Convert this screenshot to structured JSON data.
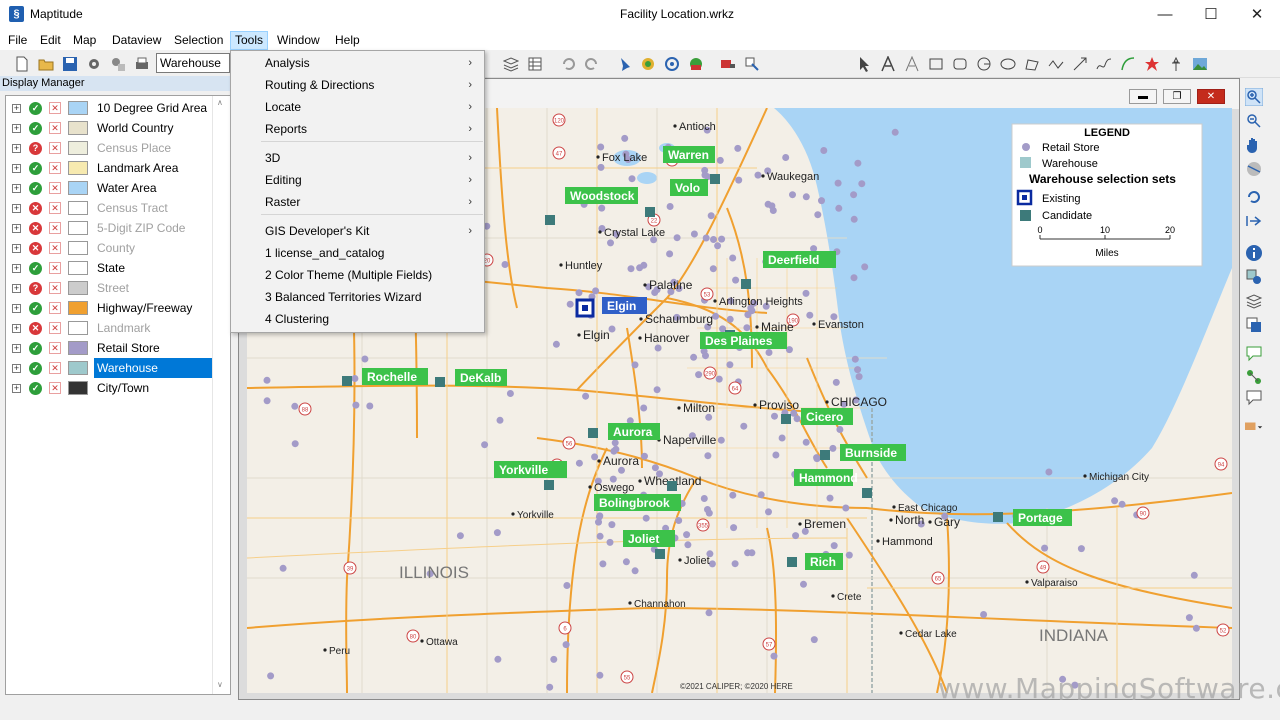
{
  "window": {
    "app_title": "Maptitude",
    "doc_title": "Facility Location.wrkz",
    "minimize": "—",
    "maximize": "☐",
    "close": "✕"
  },
  "menubar": [
    "File",
    "Edit",
    "Map",
    "Dataview",
    "Selection",
    "Tools",
    "Window",
    "Help"
  ],
  "toolbar": {
    "layer_select": "Warehouse"
  },
  "display_manager": {
    "header": "Display Manager",
    "layers": [
      {
        "label": "10 Degree Grid Area",
        "visible": "on",
        "swatch": "#a9d4f5",
        "dim": false
      },
      {
        "label": "World Country",
        "visible": "on",
        "swatch": "#e8e2cc",
        "dim": false
      },
      {
        "label": "Census Place",
        "visible": "q",
        "swatch": "#eeeedd",
        "dim": true
      },
      {
        "label": "Landmark Area",
        "visible": "on",
        "swatch": "#f7eab0",
        "dim": false
      },
      {
        "label": "Water Area",
        "visible": "on",
        "swatch": "#a9d4f5",
        "dim": false
      },
      {
        "label": "Census Tract",
        "visible": "off",
        "swatch": "#ffffff",
        "dim": true
      },
      {
        "label": "5-Digit ZIP Code",
        "visible": "off",
        "swatch": "#ffffff",
        "dim": true
      },
      {
        "label": "County",
        "visible": "off",
        "swatch": "#ffffff",
        "dim": true
      },
      {
        "label": "State",
        "visible": "on",
        "swatch": "#ffffff",
        "dim": false
      },
      {
        "label": "Street",
        "visible": "q",
        "swatch": "#cccccc",
        "dim": true
      },
      {
        "label": "Highway/Freeway",
        "visible": "on",
        "swatch": "#f0a030",
        "dim": false
      },
      {
        "label": "Landmark",
        "visible": "off",
        "swatch": "#ffffff",
        "dim": true
      },
      {
        "label": "Retail Store",
        "visible": "on",
        "swatch": "#a39bc8",
        "dim": false
      },
      {
        "label": "Warehouse",
        "visible": "on",
        "swatch": "#9ec9cc",
        "dim": false
      },
      {
        "label": "City/Town",
        "visible": "on",
        "swatch": "#333333",
        "dim": false
      }
    ]
  },
  "tools_menu": {
    "items": [
      {
        "label": "Analysis",
        "submenu": true
      },
      {
        "label": "Routing & Directions",
        "submenu": true
      },
      {
        "label": "Locate",
        "submenu": true
      },
      {
        "label": "Reports",
        "submenu": true
      },
      {
        "label": "3D",
        "submenu": true
      },
      {
        "label": "Editing",
        "submenu": true
      },
      {
        "label": "Raster",
        "submenu": true
      },
      {
        "label": "GIS Developer's Kit",
        "submenu": true
      },
      {
        "label": "1 license_and_catalog",
        "submenu": false
      },
      {
        "label": "2 Color Theme (Multiple Fields)",
        "submenu": false
      },
      {
        "label": "3 Balanced Territories Wizard",
        "submenu": false
      },
      {
        "label": "4 Clustering",
        "submenu": false
      }
    ]
  },
  "map": {
    "legend": {
      "title": "LEGEND",
      "items": [
        "Retail Store",
        "Warehouse"
      ],
      "subtitle": "Warehouse selection sets",
      "sets": [
        "Existing",
        "Candidate"
      ],
      "scale_ticks": [
        "0",
        "10",
        "20"
      ],
      "scale_unit": "Miles"
    },
    "warehouses": [
      "Warren",
      "Volo",
      "Woodstock",
      "Deerfield",
      "Elgin",
      "Des Plaines",
      "Rochelle",
      "DeKalb",
      "Aurora",
      "Cicero",
      "Burnside",
      "Yorkville",
      "Hammond",
      "Bolingbrook",
      "Joliet",
      "Rich",
      "Portage"
    ],
    "cities": [
      "Antioch",
      "Fox Lake",
      "Waukegan",
      "Crystal Lake",
      "Huntley",
      "Palatine",
      "Arlington Heights",
      "Schaumburg",
      "Maine",
      "Evanston",
      "Elgin",
      "Hanover",
      "Milton",
      "Proviso",
      "CHICAGO",
      "Naperville",
      "Aurora",
      "Oswego",
      "Wheatland",
      "Yorkville",
      "East Chicago",
      "North",
      "Gary",
      "Bremen",
      "Hammond",
      "Michigan City",
      "Joliet",
      "Channahon",
      "Crete",
      "Valparaiso",
      "Cedar Lake",
      "Ottawa",
      "Peru"
    ],
    "regions": [
      "ILLINOIS",
      "INDIANA"
    ],
    "copyright": "©2021 CALIPER; ©2020 HERE",
    "route_shields": [
      "120",
      "47",
      "173",
      "22",
      "20",
      "53",
      "190",
      "290",
      "64",
      "88",
      "56",
      "30",
      "355",
      "55",
      "39",
      "80",
      "6",
      "57",
      "65",
      "90",
      "49",
      "94",
      "52"
    ]
  },
  "watermark": "www.MappingSoftware.com"
}
